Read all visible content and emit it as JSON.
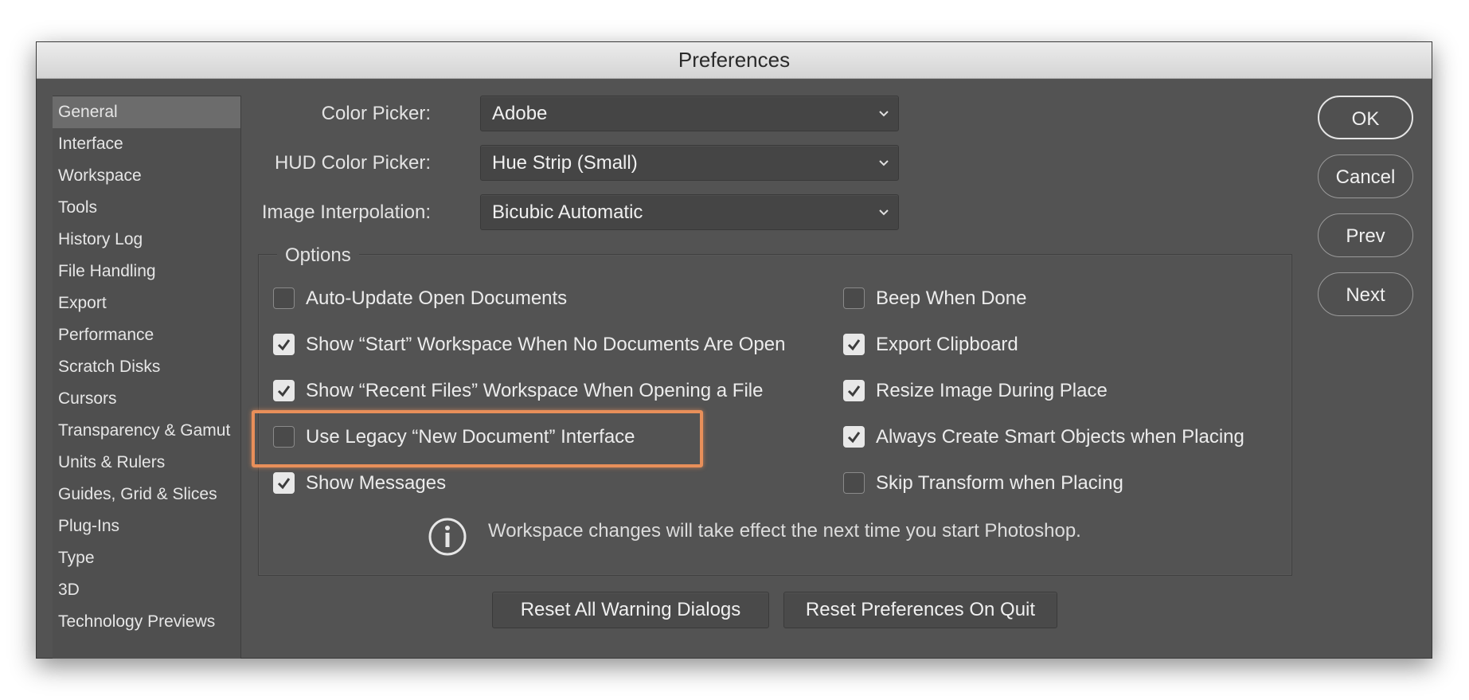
{
  "window": {
    "title": "Preferences"
  },
  "sidebar": {
    "items": [
      {
        "label": "General",
        "selected": true
      },
      {
        "label": "Interface"
      },
      {
        "label": "Workspace"
      },
      {
        "label": "Tools"
      },
      {
        "label": "History Log"
      },
      {
        "label": "File Handling"
      },
      {
        "label": "Export"
      },
      {
        "label": "Performance"
      },
      {
        "label": "Scratch Disks"
      },
      {
        "label": "Cursors"
      },
      {
        "label": "Transparency & Gamut"
      },
      {
        "label": "Units & Rulers"
      },
      {
        "label": "Guides, Grid & Slices"
      },
      {
        "label": "Plug-Ins"
      },
      {
        "label": "Type"
      },
      {
        "label": "3D"
      },
      {
        "label": "Technology Previews"
      }
    ]
  },
  "fields": {
    "color_picker": {
      "label": "Color Picker:",
      "value": "Adobe"
    },
    "hud_color_picker": {
      "label": "HUD Color Picker:",
      "value": "Hue Strip (Small)"
    },
    "image_interpolation": {
      "label": "Image Interpolation:",
      "value": "Bicubic Automatic"
    }
  },
  "options": {
    "legend": "Options",
    "left": [
      {
        "label": "Auto-Update Open Documents",
        "checked": false
      },
      {
        "label": "Show “Start” Workspace When No Documents Are Open",
        "checked": true
      },
      {
        "label": "Show “Recent Files” Workspace When Opening a File",
        "checked": true
      },
      {
        "label": "Use Legacy “New Document” Interface",
        "checked": false,
        "highlighted": true
      },
      {
        "label": "Show Messages",
        "checked": true
      }
    ],
    "right": [
      {
        "label": "Beep When Done",
        "checked": false
      },
      {
        "label": "Export Clipboard",
        "checked": true
      },
      {
        "label": "Resize Image During Place",
        "checked": true
      },
      {
        "label": "Always Create Smart Objects when Placing",
        "checked": true
      },
      {
        "label": "Skip Transform when Placing",
        "checked": false
      }
    ],
    "info_text": "Workspace changes will take effect the next time you start Photoshop."
  },
  "bottom_buttons": {
    "reset_warnings": "Reset All Warning Dialogs",
    "reset_prefs": "Reset Preferences On Quit"
  },
  "side_buttons": {
    "ok": "OK",
    "cancel": "Cancel",
    "prev": "Prev",
    "next": "Next"
  },
  "colors": {
    "dialog_bg": "#535353",
    "highlight": "#e88f5a"
  }
}
